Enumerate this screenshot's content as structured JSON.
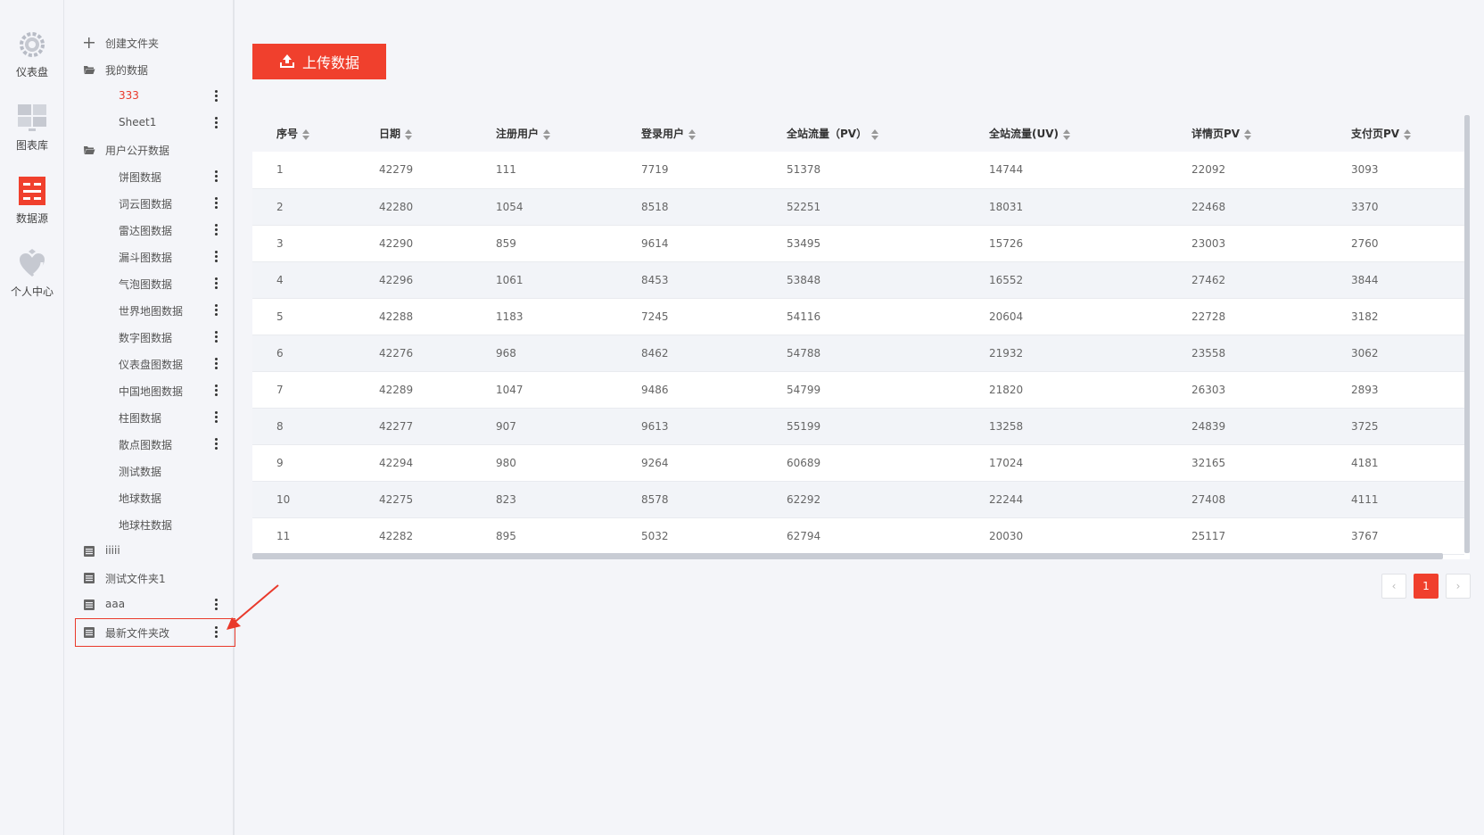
{
  "nav": {
    "items": [
      {
        "label": "仪表盘",
        "icon": "dashboard-icon"
      },
      {
        "label": "图表库",
        "icon": "chart-library-icon"
      },
      {
        "label": "数据源",
        "icon": "data-source-icon"
      },
      {
        "label": "个人中心",
        "icon": "personal-center-icon"
      }
    ]
  },
  "tree": {
    "create_folder": "创建文件夹",
    "my_data": "我的数据",
    "my_data_items": [
      "333",
      "Sheet1"
    ],
    "public_data": "用户公开数据",
    "public_items": [
      "饼图数据",
      "词云图数据",
      "雷达图数据",
      "漏斗图数据",
      "气泡图数据",
      "世界地图数据",
      "数字图数据",
      "仪表盘图数据",
      "中国地图数据",
      "柱图数据",
      "散点图数据",
      "测试数据",
      "地球数据",
      "地球柱数据"
    ],
    "folders": [
      "iiiii",
      "测试文件夹1",
      "aaa",
      "最新文件夹改"
    ]
  },
  "upload": {
    "label": "上传数据"
  },
  "table": {
    "headers": [
      "序号",
      "日期",
      "注册用户",
      "登录用户",
      "全站流量（PV）",
      "全站流量(UV)",
      "详情页PV",
      "支付页PV"
    ],
    "rows": [
      [
        "1",
        "42279",
        "111",
        "7719",
        "51378",
        "14744",
        "22092",
        "3093"
      ],
      [
        "2",
        "42280",
        "1054",
        "8518",
        "52251",
        "18031",
        "22468",
        "3370"
      ],
      [
        "3",
        "42290",
        "859",
        "9614",
        "53495",
        "15726",
        "23003",
        "2760"
      ],
      [
        "4",
        "42296",
        "1061",
        "8453",
        "53848",
        "16552",
        "27462",
        "3844"
      ],
      [
        "5",
        "42288",
        "1183",
        "7245",
        "54116",
        "20604",
        "22728",
        "3182"
      ],
      [
        "6",
        "42276",
        "968",
        "8462",
        "54788",
        "21932",
        "23558",
        "3062"
      ],
      [
        "7",
        "42289",
        "1047",
        "9486",
        "54799",
        "21820",
        "26303",
        "2893"
      ],
      [
        "8",
        "42277",
        "907",
        "9613",
        "55199",
        "13258",
        "24839",
        "3725"
      ],
      [
        "9",
        "42294",
        "980",
        "9264",
        "60689",
        "17024",
        "32165",
        "4181"
      ],
      [
        "10",
        "42275",
        "823",
        "8578",
        "62292",
        "22244",
        "27408",
        "4111"
      ],
      [
        "11",
        "42282",
        "895",
        "5032",
        "62794",
        "20030",
        "25117",
        "3767"
      ]
    ]
  },
  "pagination": {
    "prev": "‹",
    "current": "1",
    "next": "›"
  },
  "colors": {
    "accent": "#f0402d",
    "background": "#f4f5f9"
  }
}
